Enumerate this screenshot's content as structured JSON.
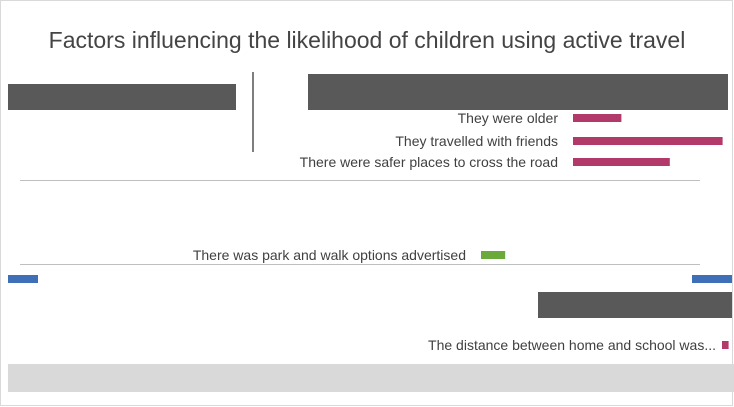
{
  "colors": {
    "pink": "#b23a6b",
    "green": "#6aaa3c",
    "blue": "#3f6fb7",
    "dark": "#595959",
    "gray": "#bfbfbf"
  },
  "chart_data": {
    "type": "bar",
    "orientation": "horizontal",
    "title": "Factors influencing the likelihood of children using active travel",
    "xlabel": "",
    "ylabel": "",
    "grid": false,
    "legend": "none",
    "visible_categories": [
      "They were older",
      "They travelled with friends",
      "There were safer places to cross the road",
      "There was park and walk options advertised",
      "The distance between home and school was..."
    ],
    "series": [
      {
        "values": [
          0.22,
          0.68,
          0.44,
          0.11,
          0.03
        ],
        "colors": [
          "pink",
          "pink",
          "pink",
          "green",
          "pink"
        ]
      }
    ]
  }
}
